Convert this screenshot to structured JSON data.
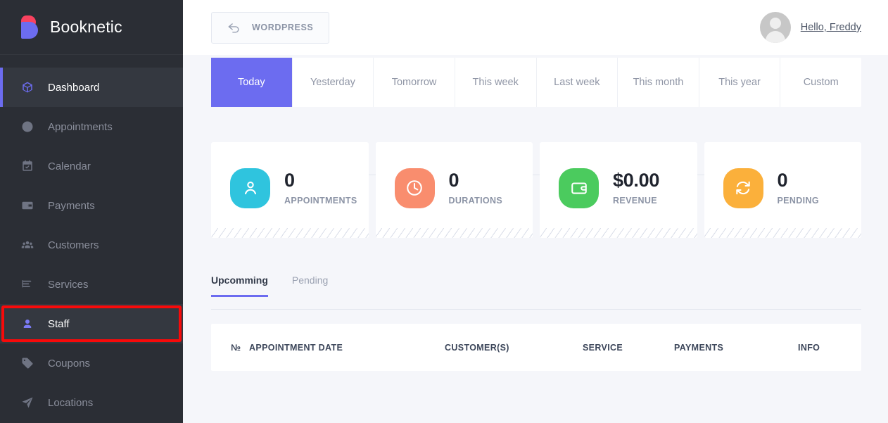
{
  "brand": {
    "name": "Booknetic",
    "logo_icon": "booknetic-b-logo"
  },
  "sidebar": {
    "items": [
      {
        "label": "Dashboard",
        "icon": "cube-icon",
        "state": "active"
      },
      {
        "label": "Appointments",
        "icon": "clock-icon",
        "state": "normal"
      },
      {
        "label": "Calendar",
        "icon": "calendar-check-icon",
        "state": "normal"
      },
      {
        "label": "Payments",
        "icon": "wallet-icon",
        "state": "normal"
      },
      {
        "label": "Customers",
        "icon": "users-group-icon",
        "state": "normal"
      },
      {
        "label": "Services",
        "icon": "list-bars-icon",
        "state": "normal"
      },
      {
        "label": "Staff",
        "icon": "person-icon",
        "state": "marked"
      },
      {
        "label": "Coupons",
        "icon": "tag-icon",
        "state": "normal"
      },
      {
        "label": "Locations",
        "icon": "paper-plane-icon",
        "state": "normal"
      }
    ]
  },
  "annotation": {
    "highlight_target": "Staff",
    "box_color": "#f80a0a",
    "arrow_color": "#e81b1b",
    "arrow_direction": "left"
  },
  "header": {
    "wordpress_button": {
      "label": "WORDPRESS",
      "icon": "back-arrow-icon"
    },
    "user": {
      "greeting": "Hello, Freddy",
      "avatar_icon": "user-avatar-placeholder"
    }
  },
  "date_range_tabs": [
    {
      "label": "Today",
      "active": true
    },
    {
      "label": "Yesterday",
      "active": false
    },
    {
      "label": "Tomorrow",
      "active": false
    },
    {
      "label": "This week",
      "active": false
    },
    {
      "label": "Last week",
      "active": false
    },
    {
      "label": "This month",
      "active": false
    },
    {
      "label": "This year",
      "active": false
    },
    {
      "label": "Custom",
      "active": false
    }
  ],
  "stats": [
    {
      "value": "0",
      "label": "APPOINTMENTS",
      "icon": "person-icon",
      "color": "#2fc4de"
    },
    {
      "value": "0",
      "label": "DURATIONS",
      "icon": "clock-icon",
      "color": "#f98d6e"
    },
    {
      "value": "$0.00",
      "label": "REVENUE",
      "icon": "wallet-icon",
      "color": "#4bcb5e"
    },
    {
      "value": "0",
      "label": "PENDING",
      "icon": "refresh-icon",
      "color": "#fbb03b"
    }
  ],
  "appointment_tabs": [
    {
      "label": "Upcomming",
      "active": true
    },
    {
      "label": "Pending",
      "active": false
    }
  ],
  "table": {
    "columns": [
      {
        "label": "№"
      },
      {
        "label": "APPOINTMENT DATE"
      },
      {
        "label": "CUSTOMER(S)"
      },
      {
        "label": "SERVICE"
      },
      {
        "label": "PAYMENTS"
      },
      {
        "label": "INFO"
      }
    ],
    "rows": []
  },
  "colors": {
    "accent": "#6c6cf0",
    "sidebar_bg": "#2b2e35",
    "sidebar_active_bg": "#343840",
    "page_bg": "#f5f6fa",
    "card_bg": "#ffffff"
  }
}
